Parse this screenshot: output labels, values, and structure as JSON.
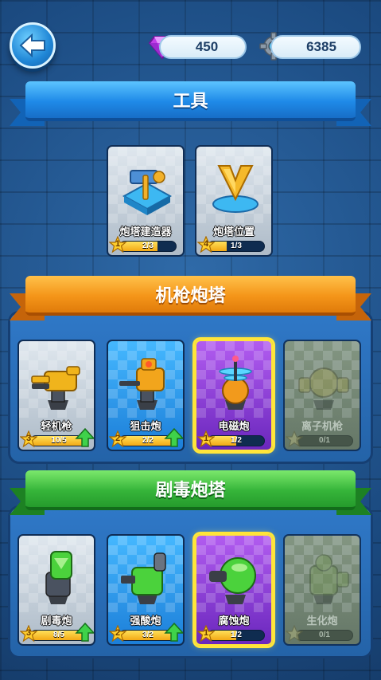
{
  "currency": {
    "gems": "450",
    "gears": "6385"
  },
  "sections": {
    "tools": {
      "title": "工具",
      "cards": [
        {
          "name": "炮塔建造器",
          "level": "1",
          "progress_text": "2/3",
          "progress": 0.667,
          "style": "gray"
        },
        {
          "name": "炮塔位置",
          "level": "4",
          "progress_text": "1/3",
          "progress": 0.333,
          "style": "gray"
        }
      ]
    },
    "machine_gun": {
      "title": "机枪炮塔",
      "cards": [
        {
          "name": "轻机枪",
          "level": "3",
          "progress_text": "10/5",
          "progress": 1.0,
          "style": "gray",
          "upgradable": true
        },
        {
          "name": "狙击炮",
          "level": "2",
          "progress_text": "2/2",
          "progress": 1.0,
          "style": "blue",
          "upgradable": true
        },
        {
          "name": "电磁炮",
          "level": "1",
          "progress_text": "1/2",
          "progress": 0.5,
          "style": "purple",
          "selected": true
        },
        {
          "name": "离子机枪",
          "level": "",
          "progress_text": "0/1",
          "progress": 0,
          "style": "locked"
        }
      ]
    },
    "poison": {
      "title": "剧毒炮塔",
      "cards": [
        {
          "name": "剧毒炮",
          "level": "3",
          "progress_text": "8/5",
          "progress": 1.0,
          "style": "gray",
          "upgradable": true
        },
        {
          "name": "强酸炮",
          "level": "2",
          "progress_text": "3/2",
          "progress": 1.0,
          "style": "blue",
          "upgradable": true
        },
        {
          "name": "腐蚀炮",
          "level": "1",
          "progress_text": "1/2",
          "progress": 0.5,
          "style": "purple",
          "selected": true
        },
        {
          "name": "生化炮",
          "level": "",
          "progress_text": "0/1",
          "progress": 0,
          "style": "locked"
        }
      ]
    }
  },
  "colors": {
    "background": "#1d4f86",
    "tools_ribbon": "#1f8ae8",
    "machine_gun_ribbon": "#f49519",
    "poison_ribbon": "#36b53a",
    "progress_fill": "#f3a915",
    "selection_frame": "#ffe53a"
  },
  "icons": {
    "back": "back-arrow-icon",
    "gems": "purple-gem-icon",
    "gears": "gear-icon",
    "level": "star-icon",
    "upgrade": "green-up-arrow-icon"
  }
}
